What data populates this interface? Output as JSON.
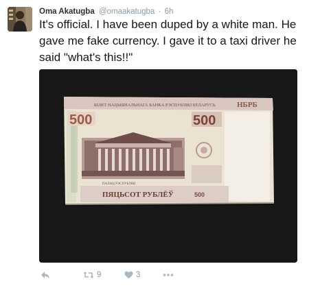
{
  "tweet": {
    "author_name": "Oma Akatugba",
    "handle": "@omaakatugba",
    "separator": "·",
    "time": "6h",
    "text": "It's official. I have been duped by a white man. He gave me fake currency. I gave it to a taxi driver he said \"what's this!!\"",
    "media": {
      "banknote": {
        "top_text": "БІЛЕТ НАЦЫЯНАЛЬНАГА БАНКА РЭСПУБЛІКІ БЕЛАРУСЬ",
        "denomination": "500",
        "denomination_word": "ПЯЦЬСОТ РУБЛЁЎ",
        "building_caption": "ПАЛАЦ РЭСПУБЛІКІ",
        "serial": "НБРБ"
      }
    },
    "actions": {
      "reply_icon": "reply-icon",
      "retweet_icon": "retweet-icon",
      "retweet_count": "9",
      "like_icon": "heart-icon",
      "like_count": "3",
      "more_icon": "more-icon"
    }
  },
  "colors": {
    "name": "#292f33",
    "meta": "#8899a6",
    "text": "#14171a",
    "icon": "#aab8c2"
  }
}
